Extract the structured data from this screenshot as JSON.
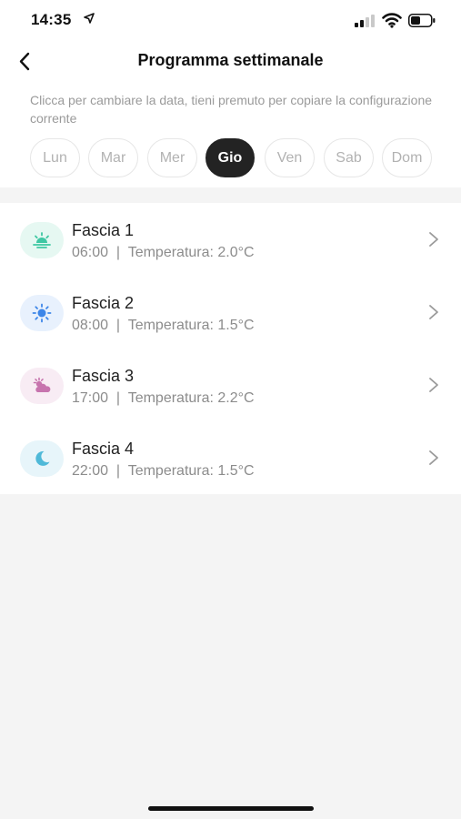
{
  "status_bar": {
    "time": "14:35"
  },
  "header": {
    "title": "Programma settimanale",
    "hint": "Clicca per cambiare la data, tieni premuto per copiare la configurazione corrente"
  },
  "days": [
    {
      "label": "Lun",
      "active": false
    },
    {
      "label": "Mar",
      "active": false
    },
    {
      "label": "Mer",
      "active": false
    },
    {
      "label": "Gio",
      "active": true
    },
    {
      "label": "Ven",
      "active": false
    },
    {
      "label": "Sab",
      "active": false
    },
    {
      "label": "Dom",
      "active": false
    }
  ],
  "slots": [
    {
      "title": "Fascia 1",
      "subtitle": "06:00  |  Temperatura: 2.0°C",
      "icon": "sunrise-icon",
      "icon_color": "#3fc7a3",
      "icon_bg": "#e6f8f2"
    },
    {
      "title": "Fascia 2",
      "subtitle": "08:00  |  Temperatura: 1.5°C",
      "icon": "sun-icon",
      "icon_color": "#3d86e8",
      "icon_bg": "#e8f1fd"
    },
    {
      "title": "Fascia 3",
      "subtitle": "17:00  |  Temperatura: 2.2°C",
      "icon": "sunset-cloud-icon",
      "icon_color": "#c774ae",
      "icon_bg": "#f8ecf4"
    },
    {
      "title": "Fascia 4",
      "subtitle": "22:00  |  Temperatura: 1.5°C",
      "icon": "moon-icon",
      "icon_color": "#4fb9d8",
      "icon_bg": "#e7f5fa"
    }
  ]
}
